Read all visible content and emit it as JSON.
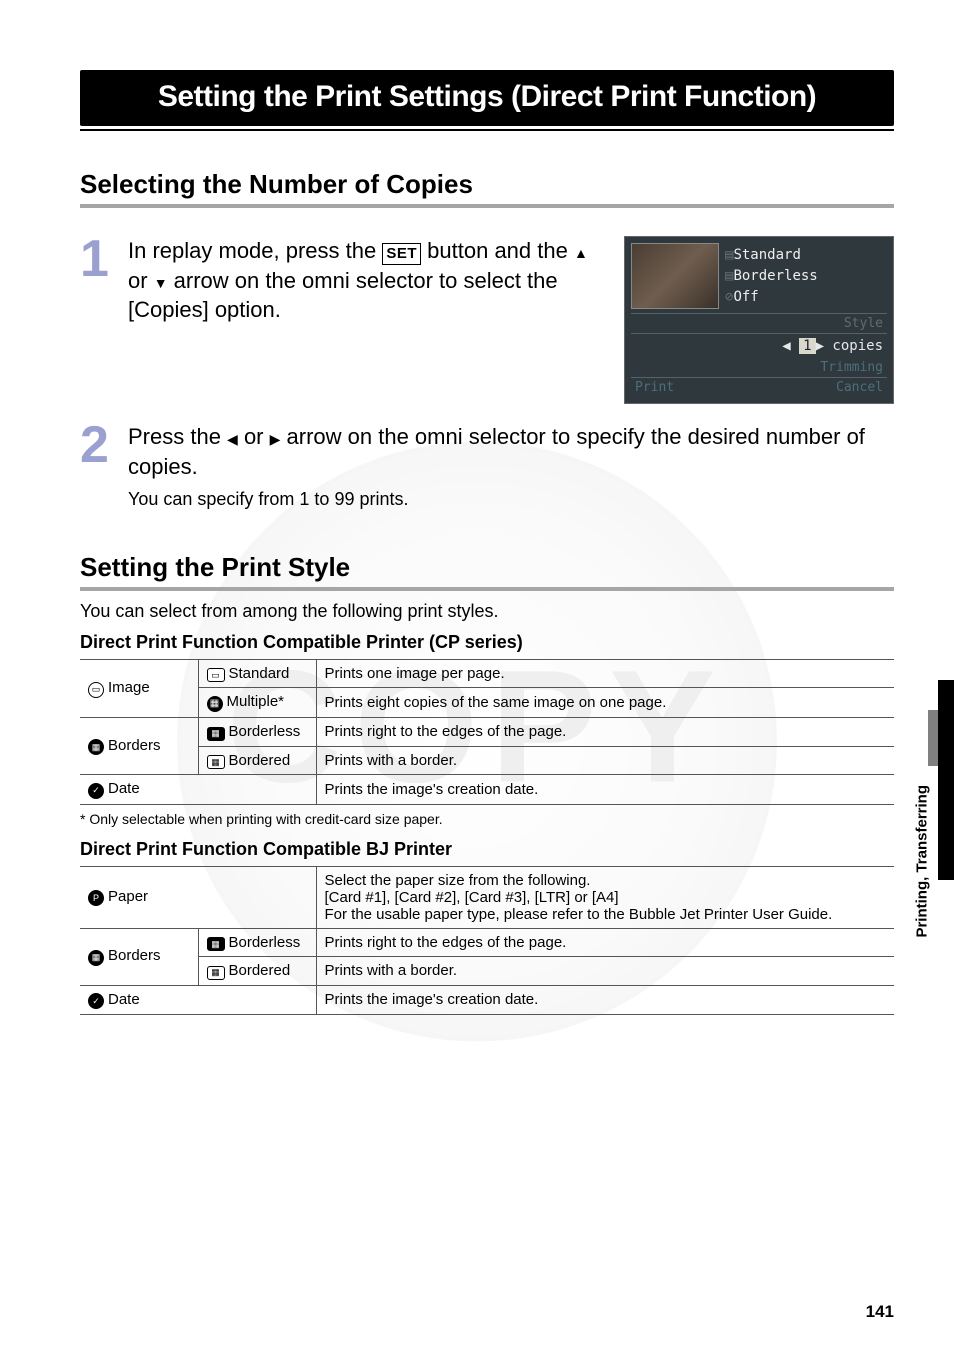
{
  "title": "Setting the Print Settings (Direct Print Function)",
  "section": {
    "copies_heading": "Selecting the Number of Copies",
    "style_heading": "Setting the Print Style"
  },
  "steps": {
    "s1": {
      "num": "1",
      "text_before_icon": "In replay mode, press the ",
      "set_label": "SET",
      "text_mid": " button and the ",
      "arrow_up": "▲",
      "or1": " or ",
      "arrow_down": "▼",
      "text_after": " arrow on the omni selector to select the [Copies] option."
    },
    "s2": {
      "num": "2",
      "text_before": "Press the ",
      "arrow_left": "◀",
      "or1": " or ",
      "arrow_right": "▶",
      "text_after": " arrow on the omni selector to specify the desired number of copies.",
      "sub": "You can specify from 1 to 99 prints."
    }
  },
  "screenshot": {
    "standard": "Standard",
    "borderless": "Borderless",
    "off": "Off",
    "style": "Style",
    "copies": "copies",
    "copies_num": "1",
    "trimming": "Trimming",
    "print": "Print",
    "cancel": "Cancel"
  },
  "style_intro": "You can select from among the following print styles.",
  "cp_heading": "Direct Print Function Compatible Printer (CP series)",
  "cp_table": {
    "image_label": "Image",
    "standard_label": "Standard",
    "standard_desc": "Prints one image per page.",
    "multiple_label": "Multiple*",
    "multiple_desc": "Prints eight copies of the same image on one page.",
    "borders_label": "Borders",
    "borderless_label": "Borderless",
    "borderless_desc": "Prints right to the edges of the page.",
    "bordered_label": "Bordered",
    "bordered_desc": "Prints with a border.",
    "date_label": "Date",
    "date_desc": "Prints the image's creation date."
  },
  "cp_footnote": "* Only selectable when printing with credit-card size paper.",
  "bj_heading": "Direct Print Function Compatible BJ Printer",
  "bj_table": {
    "paper_label": "Paper",
    "paper_desc1": "Select the paper size from the following.",
    "paper_desc2": "[Card #1], [Card #2], [Card #3], [LTR] or [A4]",
    "paper_desc3": "For the usable paper type, please refer to the Bubble Jet Printer User Guide.",
    "borders_label": "Borders",
    "borderless_label": "Borderless",
    "borderless_desc": "Prints right to the edges of the page.",
    "bordered_label": "Bordered",
    "bordered_desc": "Prints with a border.",
    "date_label": "Date",
    "date_desc": "Prints the image's creation date."
  },
  "side_tab": "Printing, Transferring",
  "page_number": "141"
}
